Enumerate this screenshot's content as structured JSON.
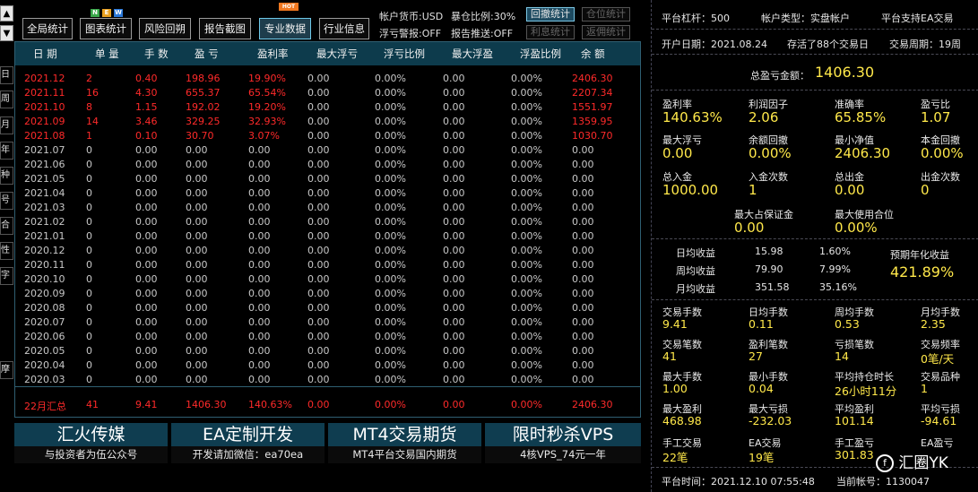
{
  "left_strip": {
    "arrow_up": "▲",
    "arrow_down": "▼",
    "tabs": [
      "日",
      "周",
      "月",
      "年",
      "种",
      "号",
      "合",
      "性",
      "字",
      "摩"
    ]
  },
  "toolbar": {
    "buttons": [
      "全局统计",
      "图表统计",
      "风险回朔",
      "报告截图",
      "专业数据",
      "行业信息"
    ],
    "badge_new": [
      "N",
      "E",
      "W"
    ],
    "badge_hot": "HOT",
    "account_currency": "帐户货币:USD",
    "max_ratio": "暴仓比例:30%",
    "float_alert": "浮亏警报:OFF",
    "report_push": "报告推送:OFF",
    "right_buttons": [
      "回撤统计",
      "仓位统计",
      "利息统计",
      "返佣统计"
    ]
  },
  "table": {
    "headers": [
      "日 期",
      "单 量",
      "手 数",
      "盈 亏",
      "盈利率",
      "最大浮亏",
      "浮亏比例",
      "最大浮盈",
      "浮盈比例",
      "余 额"
    ],
    "rows": [
      [
        "2021.12",
        "2",
        "0.40",
        "198.96",
        "19.90%",
        "0.00",
        "0.00%",
        "0.00",
        "0.00%",
        "2406.30"
      ],
      [
        "2021.11",
        "16",
        "4.30",
        "655.37",
        "65.54%",
        "0.00",
        "0.00%",
        "0.00",
        "0.00%",
        "2207.34"
      ],
      [
        "2021.10",
        "8",
        "1.15",
        "192.02",
        "19.20%",
        "0.00",
        "0.00%",
        "0.00",
        "0.00%",
        "1551.97"
      ],
      [
        "2021.09",
        "14",
        "3.46",
        "329.25",
        "32.93%",
        "0.00",
        "0.00%",
        "0.00",
        "0.00%",
        "1359.95"
      ],
      [
        "2021.08",
        "1",
        "0.10",
        "30.70",
        "3.07%",
        "0.00",
        "0.00%",
        "0.00",
        "0.00%",
        "1030.70"
      ],
      [
        "2021.07",
        "0",
        "0.00",
        "0.00",
        "0.00",
        "0.00",
        "0.00%",
        "0.00",
        "0.00%",
        "0.00"
      ],
      [
        "2021.06",
        "0",
        "0.00",
        "0.00",
        "0.00",
        "0.00",
        "0.00%",
        "0.00",
        "0.00%",
        "0.00"
      ],
      [
        "2021.05",
        "0",
        "0.00",
        "0.00",
        "0.00",
        "0.00",
        "0.00%",
        "0.00",
        "0.00%",
        "0.00"
      ],
      [
        "2021.04",
        "0",
        "0.00",
        "0.00",
        "0.00",
        "0.00",
        "0.00%",
        "0.00",
        "0.00%",
        "0.00"
      ],
      [
        "2021.03",
        "0",
        "0.00",
        "0.00",
        "0.00",
        "0.00",
        "0.00%",
        "0.00",
        "0.00%",
        "0.00"
      ],
      [
        "2021.02",
        "0",
        "0.00",
        "0.00",
        "0.00",
        "0.00",
        "0.00%",
        "0.00",
        "0.00%",
        "0.00"
      ],
      [
        "2021.01",
        "0",
        "0.00",
        "0.00",
        "0.00",
        "0.00",
        "0.00%",
        "0.00",
        "0.00%",
        "0.00"
      ],
      [
        "2020.12",
        "0",
        "0.00",
        "0.00",
        "0.00",
        "0.00",
        "0.00%",
        "0.00",
        "0.00%",
        "0.00"
      ],
      [
        "2020.11",
        "0",
        "0.00",
        "0.00",
        "0.00",
        "0.00",
        "0.00%",
        "0.00",
        "0.00%",
        "0.00"
      ],
      [
        "2020.10",
        "0",
        "0.00",
        "0.00",
        "0.00",
        "0.00",
        "0.00%",
        "0.00",
        "0.00%",
        "0.00"
      ],
      [
        "2020.09",
        "0",
        "0.00",
        "0.00",
        "0.00",
        "0.00",
        "0.00%",
        "0.00",
        "0.00%",
        "0.00"
      ],
      [
        "2020.08",
        "0",
        "0.00",
        "0.00",
        "0.00",
        "0.00",
        "0.00%",
        "0.00",
        "0.00%",
        "0.00"
      ],
      [
        "2020.07",
        "0",
        "0.00",
        "0.00",
        "0.00",
        "0.00",
        "0.00%",
        "0.00",
        "0.00%",
        "0.00"
      ],
      [
        "2020.06",
        "0",
        "0.00",
        "0.00",
        "0.00",
        "0.00",
        "0.00%",
        "0.00",
        "0.00%",
        "0.00"
      ],
      [
        "2020.05",
        "0",
        "0.00",
        "0.00",
        "0.00",
        "0.00",
        "0.00%",
        "0.00",
        "0.00%",
        "0.00"
      ],
      [
        "2020.04",
        "0",
        "0.00",
        "0.00",
        "0.00",
        "0.00",
        "0.00%",
        "0.00",
        "0.00%",
        "0.00"
      ],
      [
        "2020.03",
        "0",
        "0.00",
        "0.00",
        "0.00",
        "0.00",
        "0.00%",
        "0.00",
        "0.00%",
        "0.00"
      ]
    ],
    "summary": [
      "22月汇总",
      "41",
      "9.41",
      "1406.30",
      "140.63%",
      "0.00",
      "0.00%",
      "0.00",
      "0.00%",
      "2406.30"
    ]
  },
  "banners": [
    {
      "title": "汇火传媒",
      "sub": "与投资者为伍公众号"
    },
    {
      "title": "EA定制开发",
      "sub": "开发请加微信：ea70ea"
    },
    {
      "title": "MT4交易期货",
      "sub": "MT4平台交易国内期货"
    },
    {
      "title": "限时秒杀VPS",
      "sub": "4核VPS_74元一年"
    }
  ],
  "right": {
    "leverage": "平台杠杆：500",
    "account_type": "帐户类型：实盘帐户",
    "platform_ea": "平台支持EA交易",
    "open_date": "开户日期：2021.08.24",
    "survived": "存活了88个交易日",
    "cycle": "交易周期：19周",
    "total_pnl_label": "总盈亏金额：",
    "total_pnl_value": "1406.30",
    "grid1": [
      {
        "label": "盈利率",
        "value": "140.63%"
      },
      {
        "label": "利润因子",
        "value": "2.06"
      },
      {
        "label": "准确率",
        "value": "65.85%"
      },
      {
        "label": "盈亏比",
        "value": "1.07"
      },
      {
        "label": "最大浮亏",
        "value": "0.00"
      },
      {
        "label": "余额回撤",
        "value": "0.00%"
      },
      {
        "label": "最小净值",
        "value": "2406.30"
      },
      {
        "label": "本金回撤",
        "value": "0.00%"
      },
      {
        "label": "总入金",
        "value": "1000.00"
      },
      {
        "label": "入金次数",
        "value": "1"
      },
      {
        "label": "总出金",
        "value": "0.00"
      },
      {
        "label": "出金次数",
        "value": "0"
      }
    ],
    "margin": [
      {
        "label": "最大占保证金",
        "value": "0.00"
      },
      {
        "label": "最大使用合位",
        "value": "0.00%"
      }
    ],
    "daily": [
      {
        "label": "日均收益",
        "value": "15.98",
        "pct": "1.60%"
      },
      {
        "label": "周均收益",
        "value": "79.90",
        "pct": "7.99%"
      },
      {
        "label": "月均收益",
        "value": "351.58",
        "pct": "35.16%"
      }
    ],
    "annual_label": "预期年化收益",
    "annual_value": "421.89%",
    "grid2": [
      {
        "label": "交易手数",
        "value": "9.41"
      },
      {
        "label": "日均手数",
        "value": "0.11"
      },
      {
        "label": "周均手数",
        "value": "0.53"
      },
      {
        "label": "月均手数",
        "value": "2.35"
      },
      {
        "label": "交易笔数",
        "value": "41"
      },
      {
        "label": "盈利笔数",
        "value": "27"
      },
      {
        "label": "亏损笔数",
        "value": "14"
      },
      {
        "label": "交易频率",
        "value": "0笔/天"
      },
      {
        "label": "最大手数",
        "value": "1.00"
      },
      {
        "label": "最小手数",
        "value": "0.04"
      },
      {
        "label": "平均持仓时长",
        "value": "26小时11分"
      },
      {
        "label": "交易品种",
        "value": "1"
      },
      {
        "label": "最大盈利",
        "value": "468.98"
      },
      {
        "label": "最大亏损",
        "value": "-232.03"
      },
      {
        "label": "平均盈利",
        "value": "101.14"
      },
      {
        "label": "平均亏损",
        "value": "-94.61"
      },
      {
        "label": "手工交易",
        "value": "22笔"
      },
      {
        "label": "EA交易",
        "value": "19笔"
      },
      {
        "label": "手工盈亏",
        "value": "301.83"
      },
      {
        "label": "EA盈亏",
        "value": ""
      }
    ],
    "platform_time": "平台时间：2021.12.10 07:55:48",
    "current_account": "当前帐号：1130047",
    "watermark": "汇圈YK"
  }
}
